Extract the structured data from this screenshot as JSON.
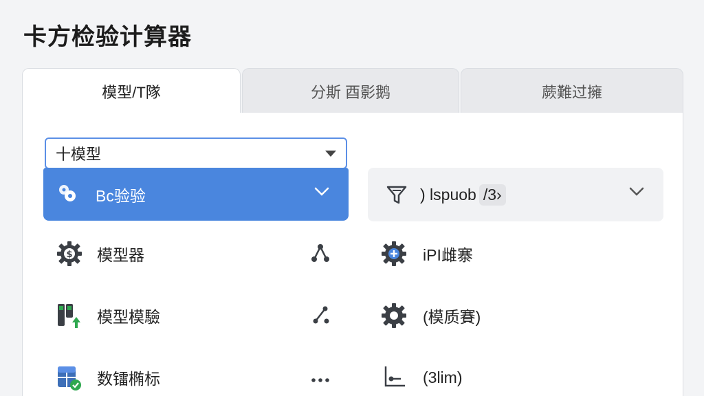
{
  "app": {
    "title": "卡方检验计算器"
  },
  "tabs": [
    {
      "label": "模型/T隊"
    },
    {
      "label": "分斯 酉影鹅"
    },
    {
      "label": "蕨難过擁"
    }
  ],
  "model_select": {
    "value": "十模型",
    "selected_item": {
      "label": "Bc验验",
      "icon": "link-dots-icon"
    },
    "items": [
      {
        "label": "模型器",
        "icon": "gear-dollar-icon",
        "action_icon": "network-icon"
      },
      {
        "label": "模型模驗",
        "icon": "bars-upload-icon",
        "action_icon": "connect-icon"
      },
      {
        "label": "数镭椭标",
        "icon": "database-check-icon",
        "action_icon": "more-icon"
      }
    ]
  },
  "filter": {
    "label": ") lspuob",
    "chip": "/3›",
    "icon": "filter-icon",
    "items": [
      {
        "label": "iPI雌寨",
        "icon": "gear-plus-icon"
      },
      {
        "label": "(模质賽)",
        "icon": "gear-icon"
      },
      {
        "label": "(3lim)",
        "icon": "chart-axis-icon"
      }
    ]
  },
  "colors": {
    "accent": "#4a86de",
    "select_border": "#5b8fe6",
    "success": "#2fa84f"
  }
}
